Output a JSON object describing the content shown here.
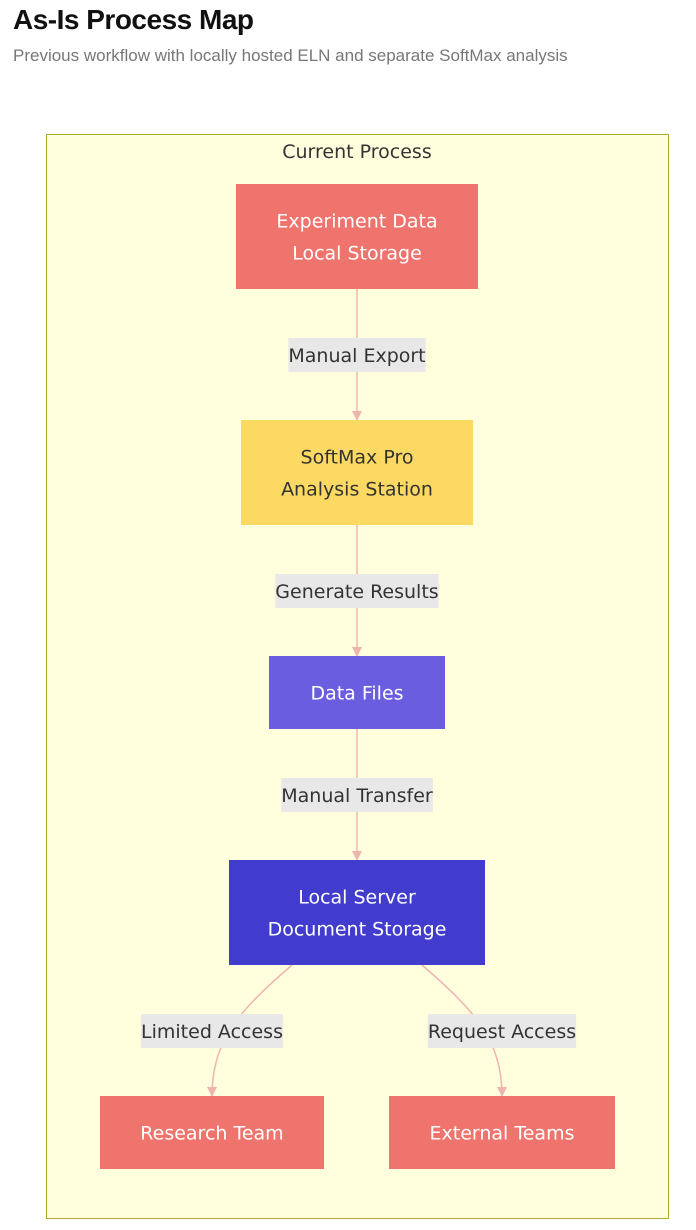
{
  "header": {
    "title": "As-Is Process Map",
    "subtitle": "Previous workflow with locally hosted ELN and separate SoftMax analysis"
  },
  "diagram": {
    "cluster": {
      "label": "Current Process"
    },
    "nodes": {
      "experiment_data": {
        "lines": [
          "Experiment Data",
          "Local Storage"
        ],
        "fill": "#ef746d",
        "text_color": "#ffffff"
      },
      "softmax": {
        "lines": [
          "SoftMax Pro",
          "Analysis Station"
        ],
        "fill": "#fbd962",
        "text_color": "#333333"
      },
      "data_files": {
        "lines": [
          "Data Files"
        ],
        "fill": "#6a5ddf",
        "text_color": "#ffffff"
      },
      "local_server": {
        "lines": [
          "Local Server",
          "Document Storage"
        ],
        "fill": "#413ccd",
        "text_color": "#ffffff"
      },
      "research_team": {
        "lines": [
          "Research Team"
        ],
        "fill": "#ef746d",
        "text_color": "#ffffff"
      },
      "external_teams": {
        "lines": [
          "External Teams"
        ],
        "fill": "#ef746d",
        "text_color": "#ffffff"
      }
    },
    "edges": [
      {
        "from": "experiment_data",
        "to": "softmax",
        "label": "Manual Export"
      },
      {
        "from": "softmax",
        "to": "data_files",
        "label": "Generate Results"
      },
      {
        "from": "data_files",
        "to": "local_server",
        "label": "Manual Transfer"
      },
      {
        "from": "local_server",
        "to": "research_team",
        "label": "Limited Access"
      },
      {
        "from": "local_server",
        "to": "external_teams",
        "label": "Request Access"
      }
    ],
    "colors": {
      "cluster_fill": "#ffffde",
      "cluster_stroke": "#aaaa33",
      "edge": "#f0b4b0",
      "edge_label_bg": "#e8e8e8"
    }
  }
}
